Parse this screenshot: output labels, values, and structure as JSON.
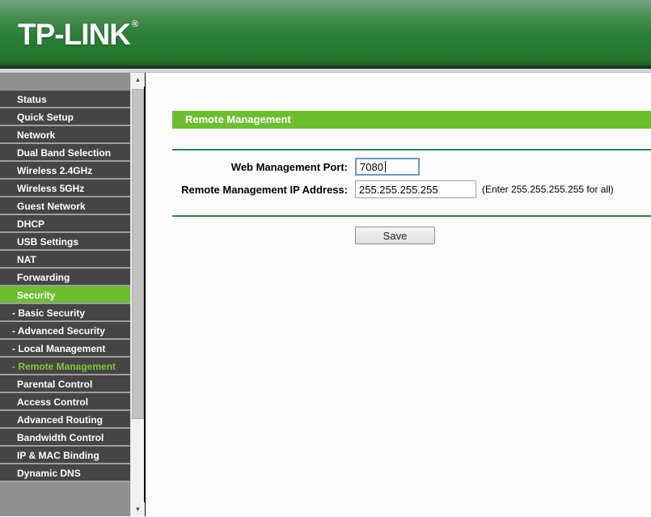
{
  "header": {
    "logo": "TP-LINK",
    "registered": "®"
  },
  "sidebar": {
    "items": [
      {
        "label": "Status"
      },
      {
        "label": "Quick Setup"
      },
      {
        "label": "Network"
      },
      {
        "label": "Dual Band Selection"
      },
      {
        "label": "Wireless 2.4GHz"
      },
      {
        "label": "Wireless 5GHz"
      },
      {
        "label": "Guest Network"
      },
      {
        "label": "DHCP"
      },
      {
        "label": "USB Settings"
      },
      {
        "label": "NAT"
      },
      {
        "label": "Forwarding"
      },
      {
        "label": "Security",
        "selected": true
      },
      {
        "label": "- Basic Security",
        "sub": true
      },
      {
        "label": "- Advanced Security",
        "sub": true
      },
      {
        "label": "- Local Management",
        "sub": true
      },
      {
        "label": "- Remote Management",
        "sub": true,
        "active": true
      },
      {
        "label": "Parental Control"
      },
      {
        "label": "Access Control"
      },
      {
        "label": "Advanced Routing"
      },
      {
        "label": "Bandwidth Control"
      },
      {
        "label": "IP & MAC Binding"
      },
      {
        "label": "Dynamic DNS"
      }
    ]
  },
  "scrollbar": {
    "up_glyph": "▲",
    "down_glyph": "▼"
  },
  "main": {
    "title": "Remote Management",
    "fields": [
      {
        "label": "Web Management Port:",
        "value": "7080"
      },
      {
        "label": "Remote Management IP Address:",
        "value": "255.255.255.255",
        "hint": "(Enter 255.255.255.255 for all)"
      }
    ],
    "save_label": "Save"
  },
  "colors": {
    "brand_green": "#6cbe2f",
    "menu_item_bg": "#454545",
    "active_sub_text": "#84c637",
    "rule_green": "#377d50",
    "focused_border": "#6d96c3"
  }
}
